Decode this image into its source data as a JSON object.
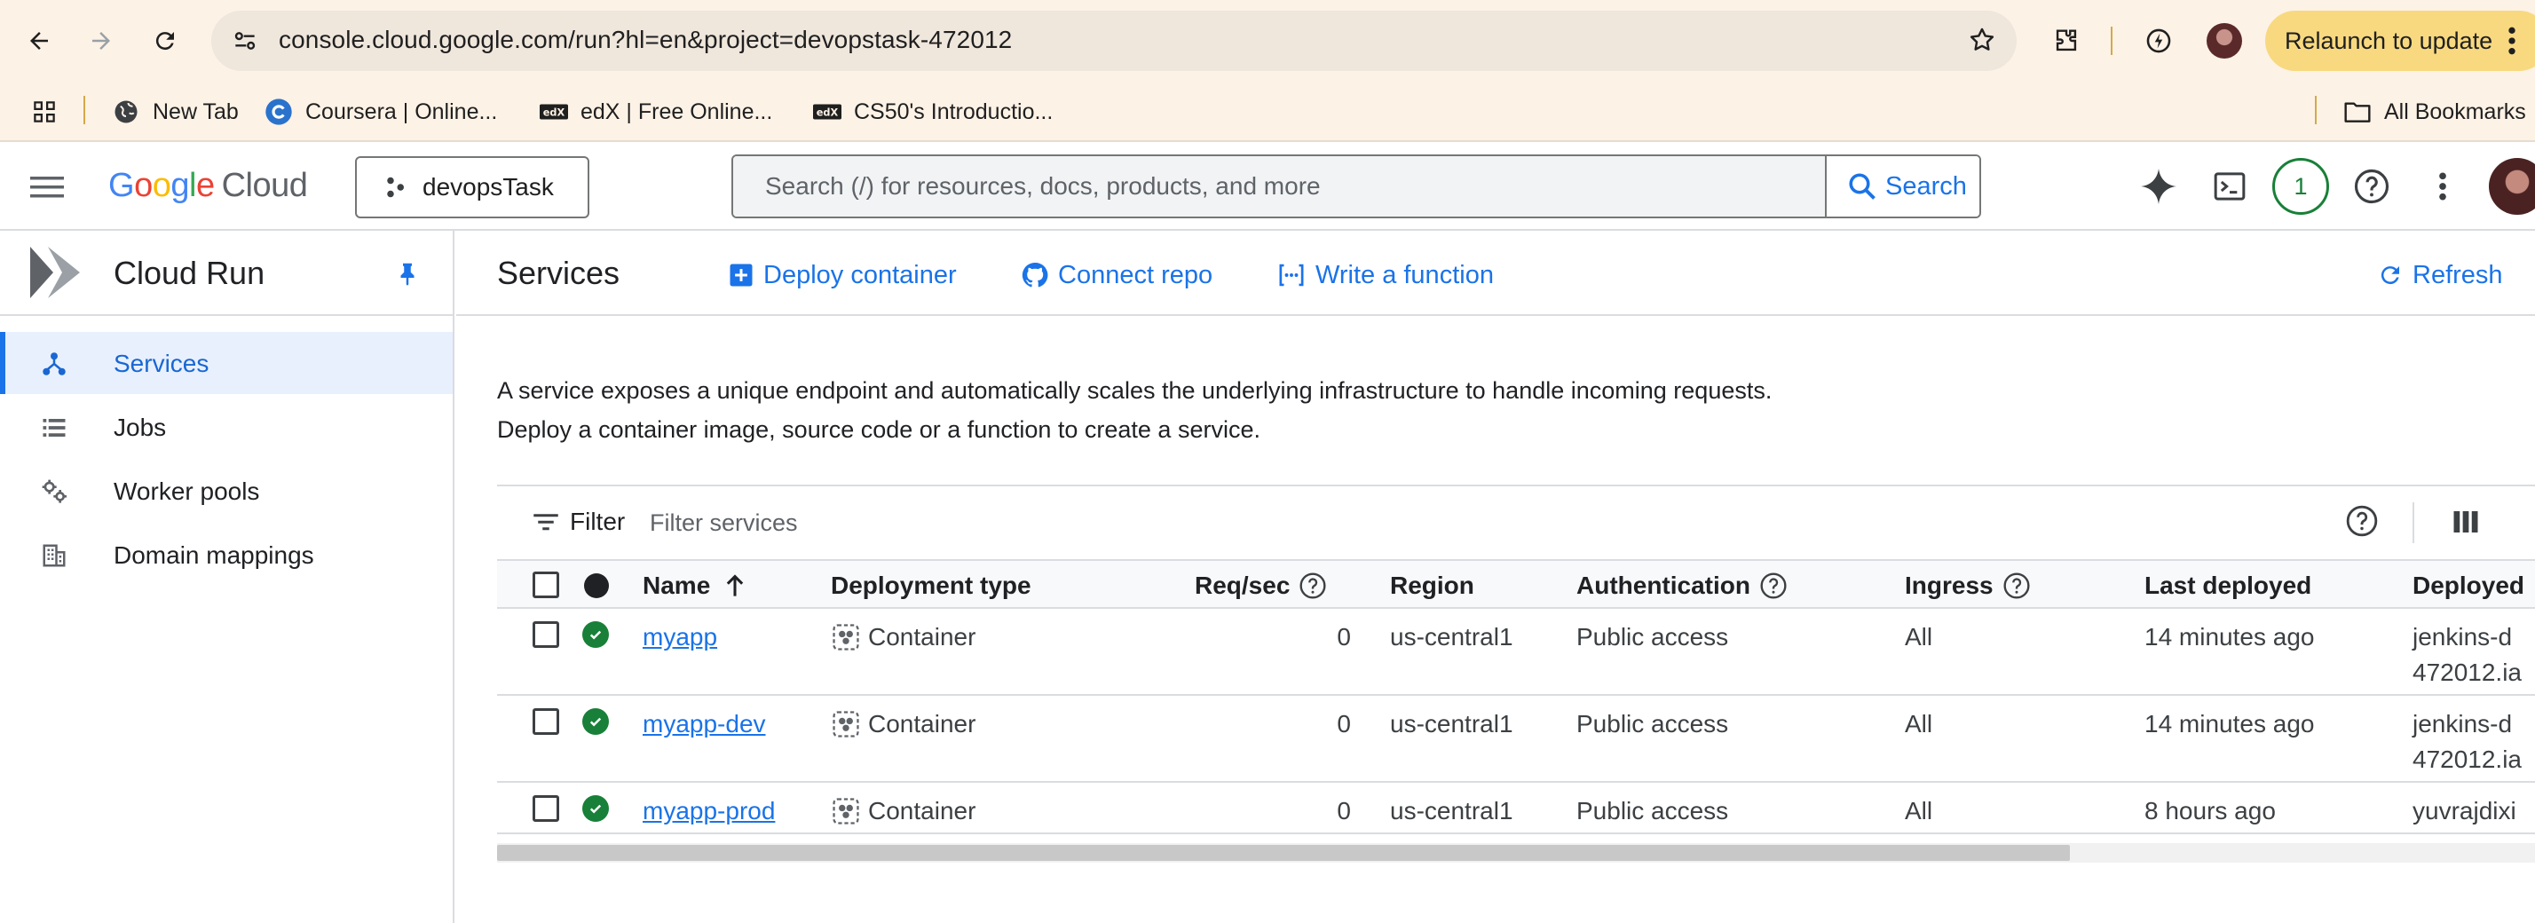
{
  "browser": {
    "url": "console.cloud.google.com/run?hl=en&project=devopstask-472012",
    "relaunch_label": "Relaunch to update",
    "bookmarks": [
      {
        "label": "New Tab",
        "icon": "globe-icon"
      },
      {
        "label": "Coursera | Online...",
        "icon": "coursera-icon"
      },
      {
        "label": "edX | Free Online...",
        "icon": "edx-icon"
      },
      {
        "label": "CS50's Introductio...",
        "icon": "edx-icon"
      }
    ],
    "all_bookmarks_label": "All Bookmarks"
  },
  "header": {
    "logo_google": "Google",
    "logo_cloud": "Cloud",
    "project_name": "devopsTask",
    "search_placeholder": "Search (/) for resources, docs, products, and more",
    "search_button_label": "Search",
    "notification_count": "1"
  },
  "sidebar": {
    "product_title": "Cloud Run",
    "items": [
      {
        "label": "Services",
        "icon": "services-icon",
        "active": true
      },
      {
        "label": "Jobs",
        "icon": "jobs-icon",
        "active": false
      },
      {
        "label": "Worker pools",
        "icon": "worker-pools-icon",
        "active": false
      },
      {
        "label": "Domain mappings",
        "icon": "domain-mappings-icon",
        "active": false
      }
    ]
  },
  "toolbar": {
    "title": "Services",
    "deploy_container": "Deploy container",
    "connect_repo": "Connect repo",
    "write_function": "Write a function",
    "refresh": "Refresh"
  },
  "description": {
    "line1": "A service exposes a unique endpoint and automatically scales the underlying infrastructure to handle incoming requests.",
    "line2": "Deploy a container image, source code or a function to create a service."
  },
  "filter": {
    "label": "Filter",
    "placeholder": "Filter services"
  },
  "table": {
    "columns": [
      "Name",
      "Deployment type",
      "Req/sec",
      "Region",
      "Authentication",
      "Ingress",
      "Last deployed",
      "Deployed"
    ],
    "rows": [
      {
        "name": "myapp",
        "deployment_type": "Container",
        "req_sec": "0",
        "region": "us-central1",
        "authentication": "Public access",
        "ingress": "All",
        "last_deployed": "14 minutes ago",
        "deployed_by_line1": "jenkins-d",
        "deployed_by_line2": "472012.ia"
      },
      {
        "name": "myapp-dev",
        "deployment_type": "Container",
        "req_sec": "0",
        "region": "us-central1",
        "authentication": "Public access",
        "ingress": "All",
        "last_deployed": "14 minutes ago",
        "deployed_by_line1": "jenkins-d",
        "deployed_by_line2": "472012.ia"
      },
      {
        "name": "myapp-prod",
        "deployment_type": "Container",
        "req_sec": "0",
        "region": "us-central1",
        "authentication": "Public access",
        "ingress": "All",
        "last_deployed": "8 hours ago",
        "deployed_by_line1": "yuvrajdixi",
        "deployed_by_line2": ""
      }
    ]
  },
  "colors": {
    "accent": "#1a73e8",
    "status_ok": "#188038",
    "active_nav_bg": "#e8f0fe",
    "relaunch_bg": "#f8d980"
  }
}
